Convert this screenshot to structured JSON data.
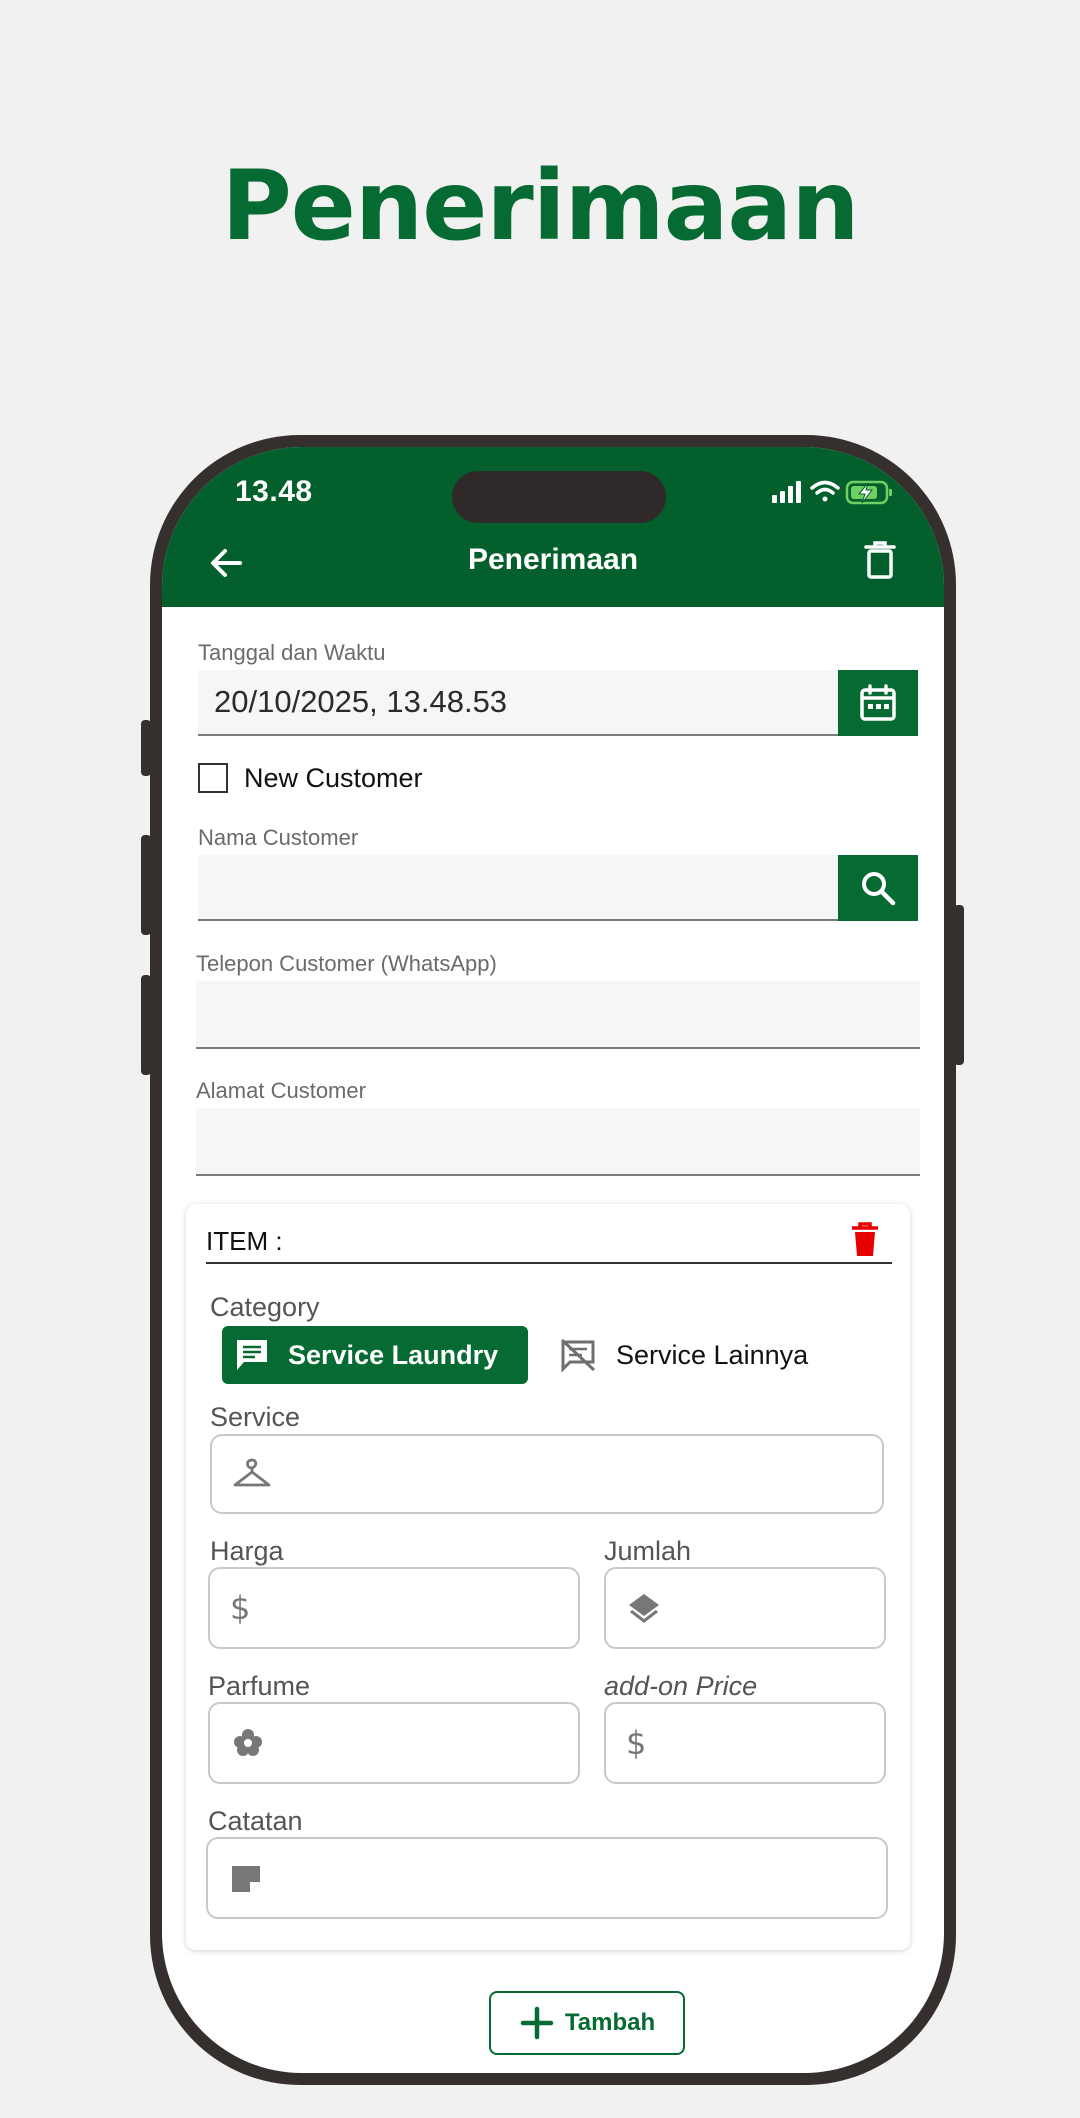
{
  "hero": {
    "title": "Penerimaan"
  },
  "status_bar": {
    "time": "13.48"
  },
  "appbar": {
    "title": "Penerimaan"
  },
  "form": {
    "date_label": "Tanggal dan Waktu",
    "date_value": "20/10/2025, 13.48.53",
    "new_customer_label": "New Customer",
    "new_customer_checked": false,
    "name_label": "Nama Customer",
    "name_value": "",
    "phone_label": "Telepon Customer (WhatsApp)",
    "phone_value": "",
    "address_label": "Alamat Customer",
    "address_value": ""
  },
  "item_card": {
    "title": "ITEM :",
    "category_label": "Category",
    "categories": [
      {
        "label": "Service Laundry",
        "selected": true,
        "icon": "message-icon"
      },
      {
        "label": "Service Lainnya",
        "selected": false,
        "icon": "comments-disabled-icon"
      }
    ],
    "service_label": "Service",
    "harga_label": "Harga",
    "jumlah_label": "Jumlah",
    "parfume_label": "Parfume",
    "addon_label": "add-on Price",
    "catatan_label": "Catatan"
  },
  "add_button": {
    "label": "Tambah"
  },
  "colors": {
    "primary": "#066b32",
    "appbar": "#03602c",
    "danger": "#e60000"
  }
}
